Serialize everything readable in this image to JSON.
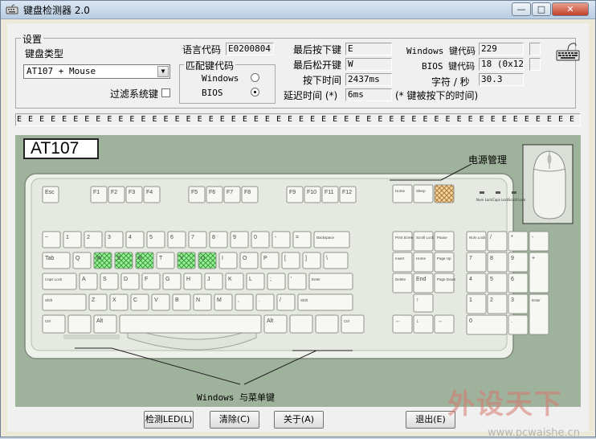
{
  "window": {
    "title": "键盘检测器 2.0",
    "minimize": "—",
    "maximize": "□",
    "close": "✕"
  },
  "settings": {
    "group_label": "设置",
    "keyboard_type_label": "键盘类型",
    "keyboard_type_value": "AT107 + Mouse",
    "filter_system_keys_label": "过滤系统键",
    "language_code_label": "语言代码",
    "language_code_value": "E0200804",
    "match_group_label": "匹配键代码",
    "match_windows_label": "Windows",
    "match_bios_label": "BIOS"
  },
  "status": {
    "last_pressed_label": "最后按下键",
    "last_pressed_value": "E",
    "last_released_label": "最后松开键",
    "last_released_value": "W",
    "press_time_label": "按下时间",
    "press_time_value": "2437ms",
    "delay_label": "延迟时间 (*)",
    "delay_value": "6ms",
    "delay_note": "(* 键被按下的时间)",
    "windows_code_label": "Windows 键代码",
    "windows_code_value": "229",
    "bios_code_label": "BIOS 键代码",
    "bios_code_value": "18 (0x12)",
    "cps_label": "字符 / 秒",
    "cps_value": "30.3"
  },
  "key_log": "E E E E E E E E E E E E E E E E E E E E E E E E E E E E E E E E E E E E E E E E E E E E E E E E E E E Q U Y R W",
  "keyboard": {
    "model_label": "AT107",
    "power_label": "电源管理",
    "winkeys_label": "Windows 与菜单键",
    "keys": {
      "esc": "Esc",
      "f": [
        "F1",
        "F2",
        "F3",
        "F4",
        "F5",
        "F6",
        "F7",
        "F8",
        "F9",
        "F10",
        "F11",
        "F12"
      ],
      "nav_top": [
        "Home",
        "Sleep",
        "Power"
      ],
      "leds": [
        "Num Lock",
        "Caps Lock",
        "Scroll Lock"
      ],
      "num_row": [
        "~",
        "1",
        "2",
        "3",
        "4",
        "5",
        "6",
        "7",
        "8",
        "9",
        "0",
        "-",
        "=",
        "Backspace"
      ],
      "tab": "Tab",
      "row_q": [
        "Q",
        "W",
        "E",
        "R",
        "T",
        "Y",
        "U",
        "I",
        "O",
        "P",
        "[",
        "]",
        "\\"
      ],
      "caps": "Caps Lock",
      "row_a": [
        "A",
        "S",
        "D",
        "F",
        "G",
        "H",
        "J",
        "K",
        "L",
        ";",
        "'"
      ],
      "enter": "Enter",
      "shift": "Shift",
      "row_z": [
        "Z",
        "X",
        "C",
        "V",
        "B",
        "N",
        "M",
        ",",
        ".",
        "/"
      ],
      "ctrl": "Ctrl",
      "alt": "Alt",
      "ins_block": [
        "Print Screen",
        "Scroll Lock",
        "Pause",
        "Insert",
        "Home",
        "Page Up",
        "Delete",
        "End",
        "Page Down"
      ],
      "arrows": [
        "↑",
        "←",
        "↓",
        "→"
      ],
      "numpad": [
        "Num Lock",
        "/",
        "*",
        "-",
        "7",
        "8",
        "9",
        "+",
        "4",
        "5",
        "6",
        "1",
        "2",
        "3",
        "Enter",
        "0",
        "."
      ]
    }
  },
  "buttons": {
    "detect_led": "检测LED(L)",
    "clear": "清除(C)",
    "about": "关于(A)",
    "exit": "退出(E)"
  },
  "watermark": {
    "brand": "外设天下",
    "url": "www.pcwaishe.cn"
  }
}
